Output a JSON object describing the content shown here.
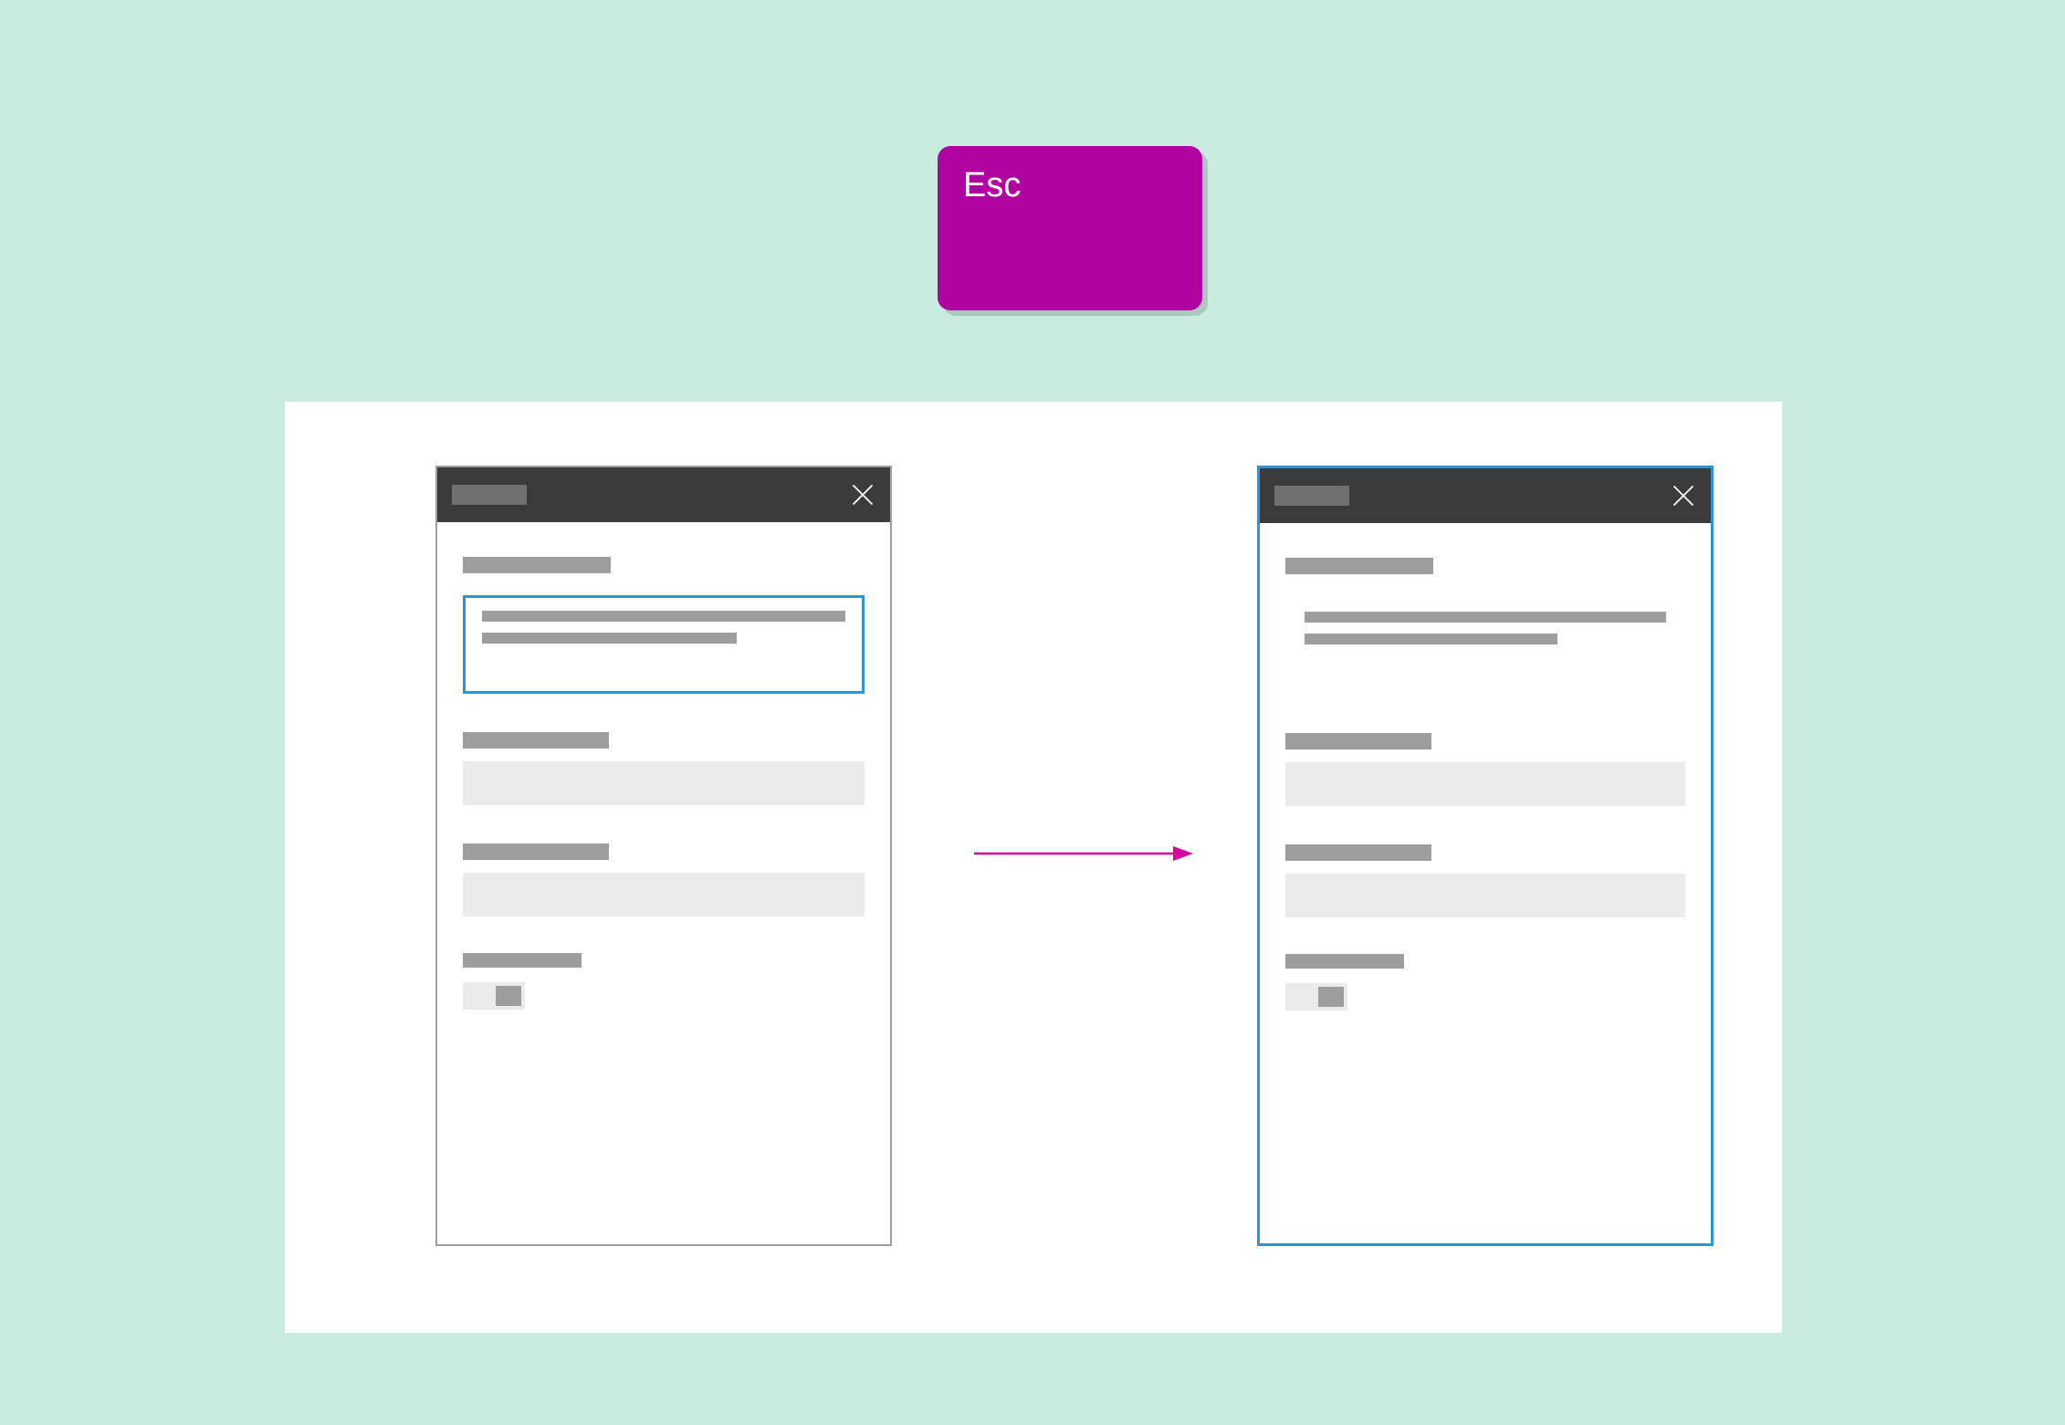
{
  "colors": {
    "background": "#c9ece0",
    "key": "#b004a0",
    "stage": "#ffffff",
    "titlebar": "#3b3b3b",
    "focus": "#2b95d6",
    "arrow": "#d4009e",
    "placeholder_dark": "#9e9e9e",
    "placeholder_light": "#ebebeb"
  },
  "key": {
    "label": "Esc"
  },
  "diagram": {
    "left_state": "inner-element-focused",
    "right_state": "dialog-focused",
    "transition": "Esc moves focus from inner control to dialog container"
  }
}
